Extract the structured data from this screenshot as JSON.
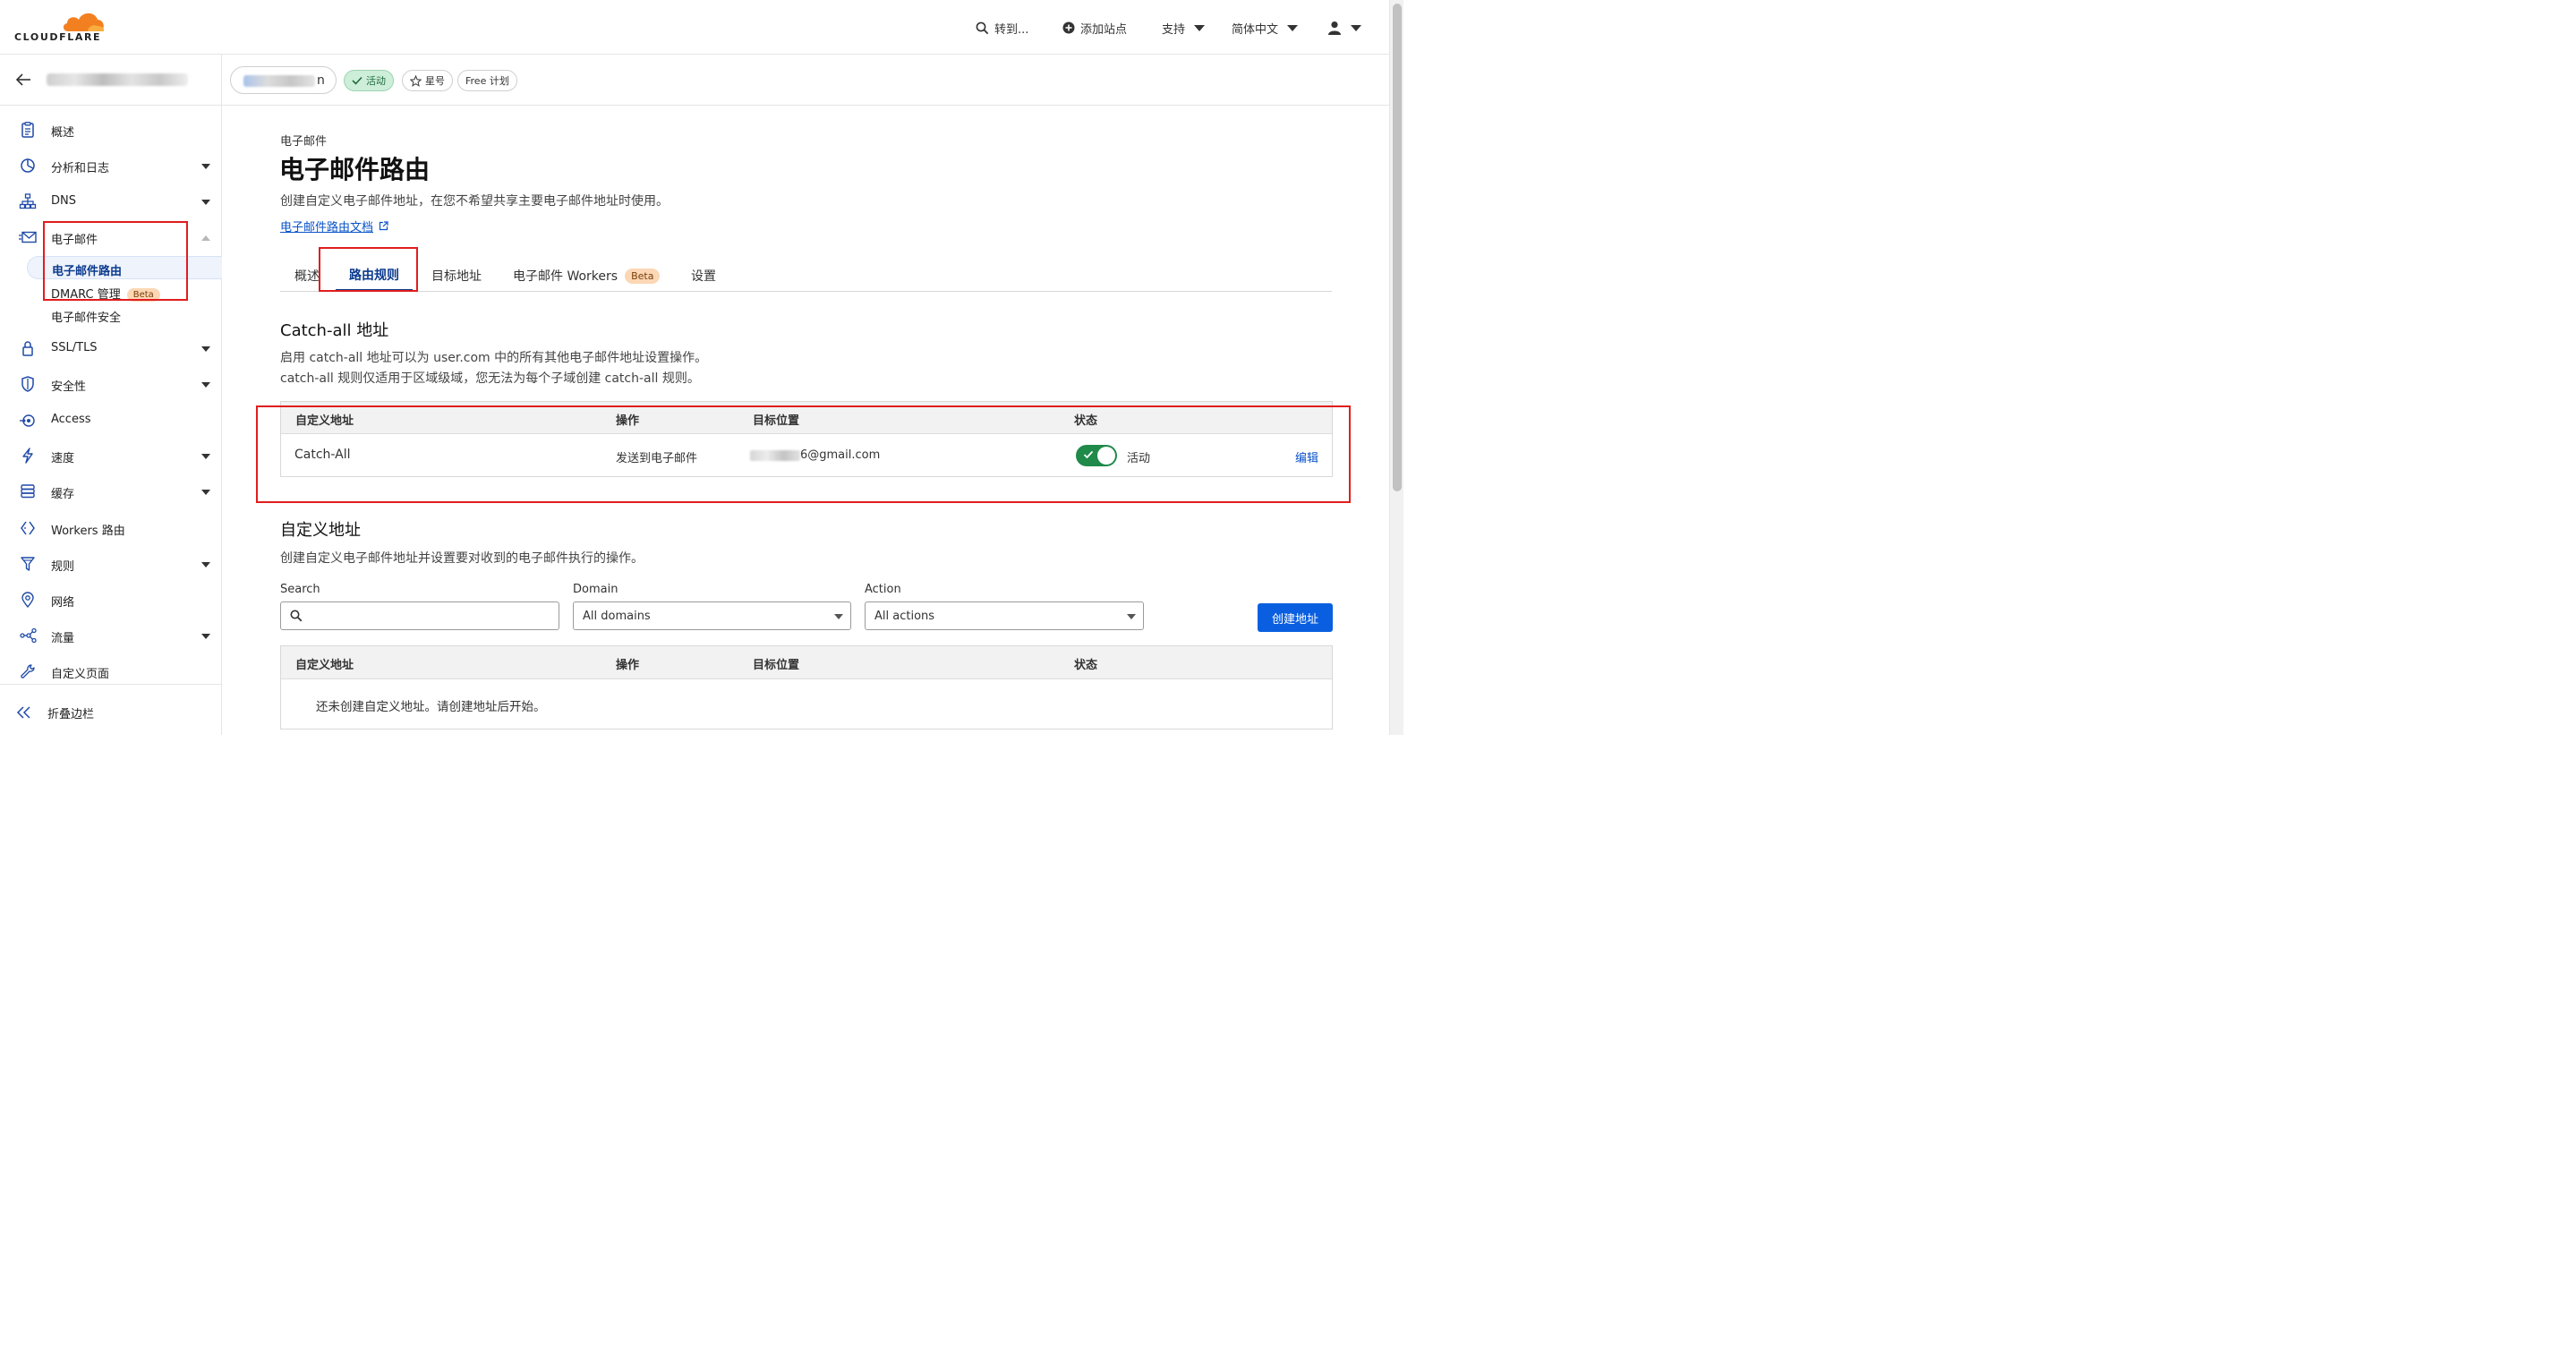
{
  "brand": {
    "wordmark": "CLOUDFLARE",
    "accent": "#f38020"
  },
  "topbar": {
    "goto": "转到...",
    "add_site": "添加站点",
    "support": "支持",
    "language": "简体中文"
  },
  "zone": {
    "name_tail": "n",
    "status": "活动",
    "star": "星号",
    "plan": "Free 计划"
  },
  "sidebar": {
    "items": [
      {
        "label": "概述",
        "icon": "clipboard-icon",
        "caret": ""
      },
      {
        "label": "分析和日志",
        "icon": "pie-chart-icon",
        "caret": "down"
      },
      {
        "label": "DNS",
        "icon": "network-icon",
        "caret": "down"
      },
      {
        "label": "电子邮件",
        "icon": "email-icon",
        "caret": "up"
      },
      {
        "label": "SSL/TLS",
        "icon": "lock-icon",
        "caret": "down"
      },
      {
        "label": "安全性",
        "icon": "shield-icon",
        "caret": "down"
      },
      {
        "label": "Access",
        "icon": "access-icon",
        "caret": ""
      },
      {
        "label": "速度",
        "icon": "lightning-icon",
        "caret": "down"
      },
      {
        "label": "缓存",
        "icon": "cache-icon",
        "caret": "down"
      },
      {
        "label": "Workers 路由",
        "icon": "workers-icon",
        "caret": ""
      },
      {
        "label": "规则",
        "icon": "funnel-icon",
        "caret": "down"
      },
      {
        "label": "网络",
        "icon": "location-pin-icon",
        "caret": ""
      },
      {
        "label": "流量",
        "icon": "traffic-icon",
        "caret": "down"
      },
      {
        "label": "自定义页面",
        "icon": "wrench-icon",
        "caret": ""
      }
    ],
    "email_sub": [
      {
        "label": "电子邮件路由",
        "active": true
      },
      {
        "label": "DMARC 管理",
        "badge": "Beta"
      },
      {
        "label": "电子邮件安全"
      }
    ],
    "collapse": "折叠边栏"
  },
  "page": {
    "breadcrumb": "电子邮件",
    "title": "电子邮件路由",
    "description": "创建自定义电子邮件地址，在您不希望共享主要电子邮件地址时使用。",
    "doc_link": "电子邮件路由文档"
  },
  "tabs": [
    {
      "label": "概述"
    },
    {
      "label": "路由规则",
      "active": true
    },
    {
      "label": "目标地址"
    },
    {
      "label": "电子邮件 Workers",
      "badge": "Beta"
    },
    {
      "label": "设置"
    }
  ],
  "catchall": {
    "title": "Catch-all 地址",
    "desc_line1": "启用 catch-all 地址可以为 user.com 中的所有其他电子邮件地址设置操作。",
    "desc_line2": "catch-all 规则仅适用于区域级域，您无法为每个子域创建 catch-all 规则。",
    "columns": [
      "自定义地址",
      "操作",
      "目标位置",
      "状态"
    ],
    "row": {
      "address": "Catch-All",
      "action": "发送到电子邮件",
      "destination_tail": "6@gmail.com",
      "status": "活动",
      "enabled": true,
      "edit": "编辑"
    }
  },
  "custom": {
    "title": "自定义地址",
    "description": "创建自定义电子邮件地址并设置要对收到的电子邮件执行的操作。",
    "search_label": "Search",
    "search_placeholder": "",
    "domain_label": "Domain",
    "domain_value": "All domains",
    "action_label": "Action",
    "action_value": "All actions",
    "create_button": "创建地址",
    "columns": [
      "自定义地址",
      "操作",
      "目标位置",
      "状态"
    ],
    "empty": "还未创建自定义地址。请创建地址后开始。"
  }
}
